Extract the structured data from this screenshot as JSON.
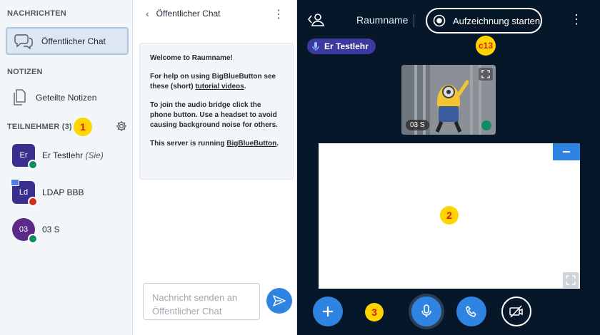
{
  "sidebar": {
    "messages_title": "NACHRICHTEN",
    "public_chat_label": "Öffentlicher Chat",
    "notes_title": "NOTIZEN",
    "shared_notes_label": "Geteilte Notizen",
    "participants_title": "TEILNEHMER (3)",
    "users": [
      {
        "initials": "Er",
        "name": "Er Testlehr",
        "suffix": "(Sie)"
      },
      {
        "initials": "Ld",
        "name": "LDAP BBB",
        "suffix": ""
      },
      {
        "initials": "03",
        "name": "03 S",
        "suffix": ""
      }
    ]
  },
  "markers": {
    "m1": "1",
    "m2": "2",
    "m3": "3",
    "c13": "c13"
  },
  "chat": {
    "title": "Öffentlicher Chat",
    "welcome_line1": "Welcome to Raumname!",
    "welcome_help_prefix": "For help on using BigBlueButton see these (short) ",
    "welcome_help_link": "tutorial videos",
    "welcome_help_suffix": ".",
    "welcome_audio": "To join the audio bridge click the phone button. Use a headset to avoid causing background noise for others.",
    "welcome_server_prefix": "This server is running ",
    "welcome_server_link": "BigBlueButton",
    "welcome_server_suffix": ".",
    "input_placeholder": "Nachricht senden an Öffentlicher Chat"
  },
  "main": {
    "room_name": "Raumname",
    "record_label": "Aufzeichnung starten",
    "talking_user": "Er Testlehr",
    "webcam_user": "03 S"
  },
  "colors": {
    "accent": "#2f83e1",
    "dark_bg": "#06172a",
    "talker_bg": "#3c3aa0",
    "marker": "#ffd400"
  },
  "icons": [
    "chat-icon",
    "notes-icon",
    "gear-icon",
    "back-icon",
    "more-icon",
    "send-icon",
    "user-list-icon",
    "record-icon",
    "mic-icon",
    "expand-icon",
    "headset-icon",
    "plus-icon",
    "phone-icon",
    "camera-off-icon",
    "fullscreen-icon",
    "minimize-icon"
  ]
}
